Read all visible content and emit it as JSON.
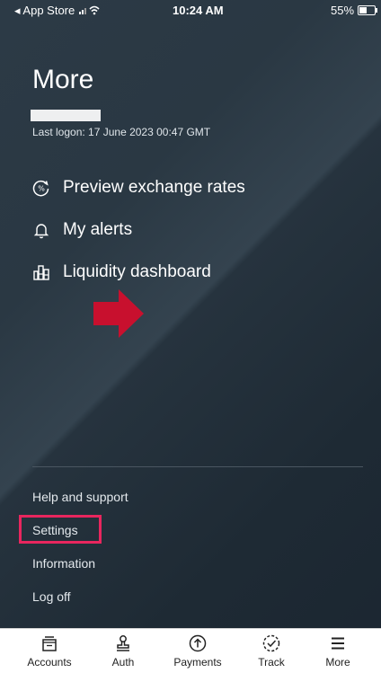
{
  "status_bar": {
    "carrier": "◂ App Store",
    "time": "10:24 AM",
    "battery": "55%"
  },
  "page": {
    "title": "More",
    "last_logon": "Last logon: 17 June 2023 00:47 GMT"
  },
  "menu": [
    {
      "label": "Preview exchange rates",
      "icon": "exchange-rates-icon"
    },
    {
      "label": "My alerts",
      "icon": "bell-icon"
    },
    {
      "label": "Liquidity dashboard",
      "icon": "bar-chart-icon"
    }
  ],
  "links": [
    {
      "label": "Help and support"
    },
    {
      "label": "Settings",
      "highlighted": true
    },
    {
      "label": "Information"
    },
    {
      "label": "Log off"
    }
  ],
  "tabs": [
    {
      "label": "Accounts",
      "icon": "accounts-icon"
    },
    {
      "label": "Auth",
      "icon": "stamp-icon"
    },
    {
      "label": "Payments",
      "icon": "upload-circle-icon"
    },
    {
      "label": "Track",
      "icon": "check-circle-icon"
    },
    {
      "label": "More",
      "icon": "hamburger-icon",
      "active": true
    }
  ],
  "colors": {
    "accent_red": "#c8102e",
    "highlight_pink": "#e8265e",
    "background": "#1b2631"
  }
}
